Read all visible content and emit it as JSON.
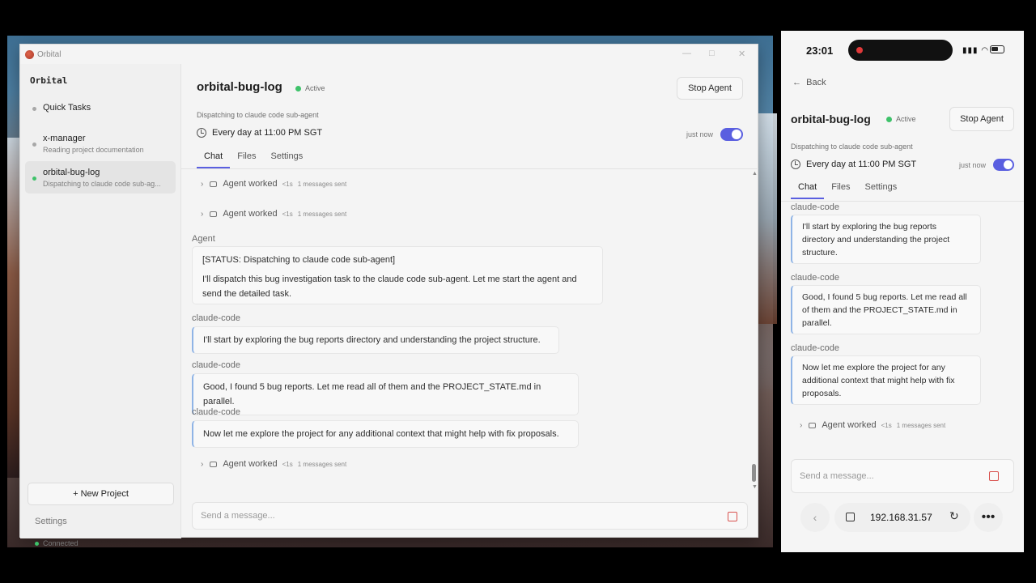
{
  "desktop": {
    "window_title": "Orbital",
    "window_controls": [
      "—",
      "□",
      "✕"
    ]
  },
  "sidebar": {
    "brand": "Orbital",
    "items": [
      {
        "name": "Quick Tasks",
        "sub": "",
        "status": "idle"
      },
      {
        "name": "x-manager",
        "sub": "Reading project documentation",
        "status": "idle"
      },
      {
        "name": "orbital-bug-log",
        "sub": "Dispatching to claude code sub-ag...",
        "status": "active"
      }
    ],
    "new_project": "+ New Project",
    "settings": "Settings",
    "connection": "Connected"
  },
  "header": {
    "title": "orbital-bug-log",
    "status": "Active",
    "stop_button": "Stop Agent",
    "dispatch_text": "Dispatching to claude code sub-agent",
    "schedule": "Every day at 11:00 PM SGT",
    "last_run": "just now",
    "schedule_enabled": true
  },
  "tabs": [
    "Chat",
    "Files",
    "Settings"
  ],
  "active_tab": "Chat",
  "chat": {
    "worked_1": {
      "label": "Agent worked",
      "time": "<1s",
      "count": "1 messages sent"
    },
    "worked_2": {
      "label": "Agent worked",
      "time": "<1s",
      "count": "1 messages sent"
    },
    "agent_sender": "Agent",
    "agent_status": "[STATUS: Dispatching to claude code sub-agent]",
    "agent_text": "I'll dispatch this bug investigation task to the claude code sub-agent. Let me start the agent and send the detailed task.",
    "messages": [
      {
        "sender": "claude-code",
        "text": "I'll start by exploring the bug reports directory and understanding the project structure."
      },
      {
        "sender": "claude-code",
        "text": "Good, I found 5 bug reports. Let me read all of them and the PROJECT_STATE.md in parallel."
      },
      {
        "sender": "claude-code",
        "text": "Now let me explore the project for any additional context that might help with fix proposals."
      }
    ],
    "worked_3": {
      "label": "Agent worked",
      "time": "<1s",
      "count": "1 messages sent"
    },
    "composer_placeholder": "Send a message..."
  },
  "phone": {
    "time": "23:01",
    "back": "Back",
    "title": "orbital-bug-log",
    "status": "Active",
    "stop_button": "Stop Agent",
    "dispatch_text": "Dispatching to claude code sub-agent",
    "schedule": "Every day at 11:00 PM SGT",
    "last_run": "just now",
    "tabs": [
      "Chat",
      "Files",
      "Settings"
    ],
    "messages": [
      {
        "sender": "claude-code",
        "text": "I'll start by exploring the bug reports directory and understanding the project structure."
      },
      {
        "sender": "claude-code",
        "text": "Good, I found 5 bug reports. Let me read all of them and the PROJECT_STATE.md in parallel."
      },
      {
        "sender": "claude-code",
        "text": "Now let me explore the project for any additional context that might help with fix proposals."
      }
    ],
    "worked": {
      "label": "Agent worked",
      "time": "<1s",
      "count": "1 messages sent"
    },
    "composer_placeholder": "Send a message...",
    "url": "192.168.31.57"
  },
  "colors": {
    "accent": "#5a5fe0",
    "active_dot": "#3ec26a",
    "stop_red": "#d9534f",
    "code_border": "#8fb4e6"
  }
}
